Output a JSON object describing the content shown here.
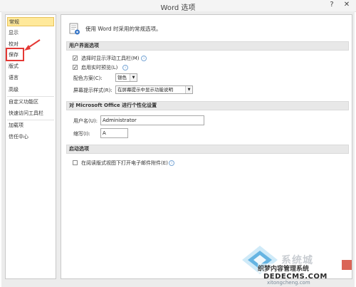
{
  "window": {
    "title": "Word 选项",
    "help_glyph": "?",
    "close_glyph": "✕"
  },
  "sidebar": {
    "items": [
      {
        "label": "常规"
      },
      {
        "label": "显示"
      },
      {
        "label": "校对"
      },
      {
        "label": "保存"
      },
      {
        "label": "版式"
      },
      {
        "label": "语言"
      },
      {
        "label": "高级"
      },
      {
        "label": "自定义功能区"
      },
      {
        "label": "快速访问工具栏"
      },
      {
        "label": "加载项"
      },
      {
        "label": "信任中心"
      }
    ]
  },
  "main": {
    "header_text": "使用 Word 时采用的常规选项。",
    "ui_section": {
      "title": "用户界面选项",
      "option_minitoolbar": "选择时显示浮动工具栏(M)",
      "option_livepreview": "启用实时预览(L)",
      "color_scheme_label": "配色方案(C):",
      "color_scheme_value": "银色",
      "screentip_label": "屏幕提示样式(R):",
      "screentip_value": "在屏幕提示中显示功能说明"
    },
    "personalize_section": {
      "title": "对 Microsoft Office 进行个性化设置",
      "username_label": "用户名(U):",
      "username_value": "Administrator",
      "initials_label": "缩写(I):",
      "initials_value": "A"
    },
    "startup_section": {
      "title": "启动选项",
      "option_readingview": "在阅读版式视图下打开电子邮件附件(E)"
    }
  },
  "watermark": {
    "line1": "系统城",
    "line2": "织梦内容管理系统",
    "line3": "DEDECMS.COM",
    "line4": "xitongcheng.com"
  }
}
